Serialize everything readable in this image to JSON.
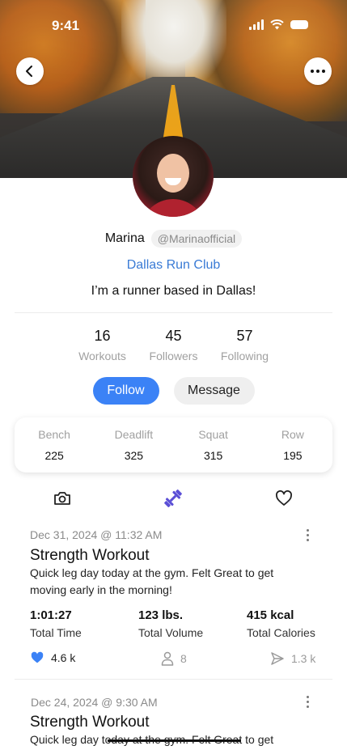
{
  "status_bar": {
    "time": "9:41"
  },
  "profile": {
    "name": "Marina",
    "handle": "@Marinaofficial",
    "club": "Dallas Run Club",
    "bio": "I’m a runner based in Dallas!"
  },
  "stats": [
    {
      "value": "16",
      "label": "Workouts"
    },
    {
      "value": "45",
      "label": "Followers"
    },
    {
      "value": "57",
      "label": "Following"
    }
  ],
  "buttons": {
    "follow": "Follow",
    "message": "Message"
  },
  "lifts": [
    {
      "label": "Bench",
      "value": "225"
    },
    {
      "label": "Deadlift",
      "value": "325"
    },
    {
      "label": "Squat",
      "value": "315"
    },
    {
      "label": "Row",
      "value": "195"
    }
  ],
  "tabs": {
    "photos_icon": "camera-icon",
    "workouts_icon": "dumbbell-icon",
    "likes_icon": "heart-icon",
    "active_color": "#5b4fd6"
  },
  "posts": [
    {
      "date": "Dec 31, 2024 @ 11:32 AM",
      "title": "Strength Workout",
      "description": "Quick leg day today at the gym. Felt Great to get moving early in the morning!",
      "metrics": [
        {
          "value": "1:01:27",
          "label": "Total Time"
        },
        {
          "value": "123 lbs.",
          "label": "Total Volume"
        },
        {
          "value": "415 kcal",
          "label": "Total Calories"
        }
      ],
      "likes": "4.6 k",
      "participants": "8",
      "shares": "1.3 k"
    },
    {
      "date": "Dec 24, 2024 @ 9:30 AM",
      "title": "Strength Workout",
      "description": "Quick leg day today at the gym. Felt Great to get"
    }
  ],
  "colors": {
    "accent": "#3b82f6",
    "club_link": "#3a7bd5",
    "like_heart": "#3b82f6"
  }
}
